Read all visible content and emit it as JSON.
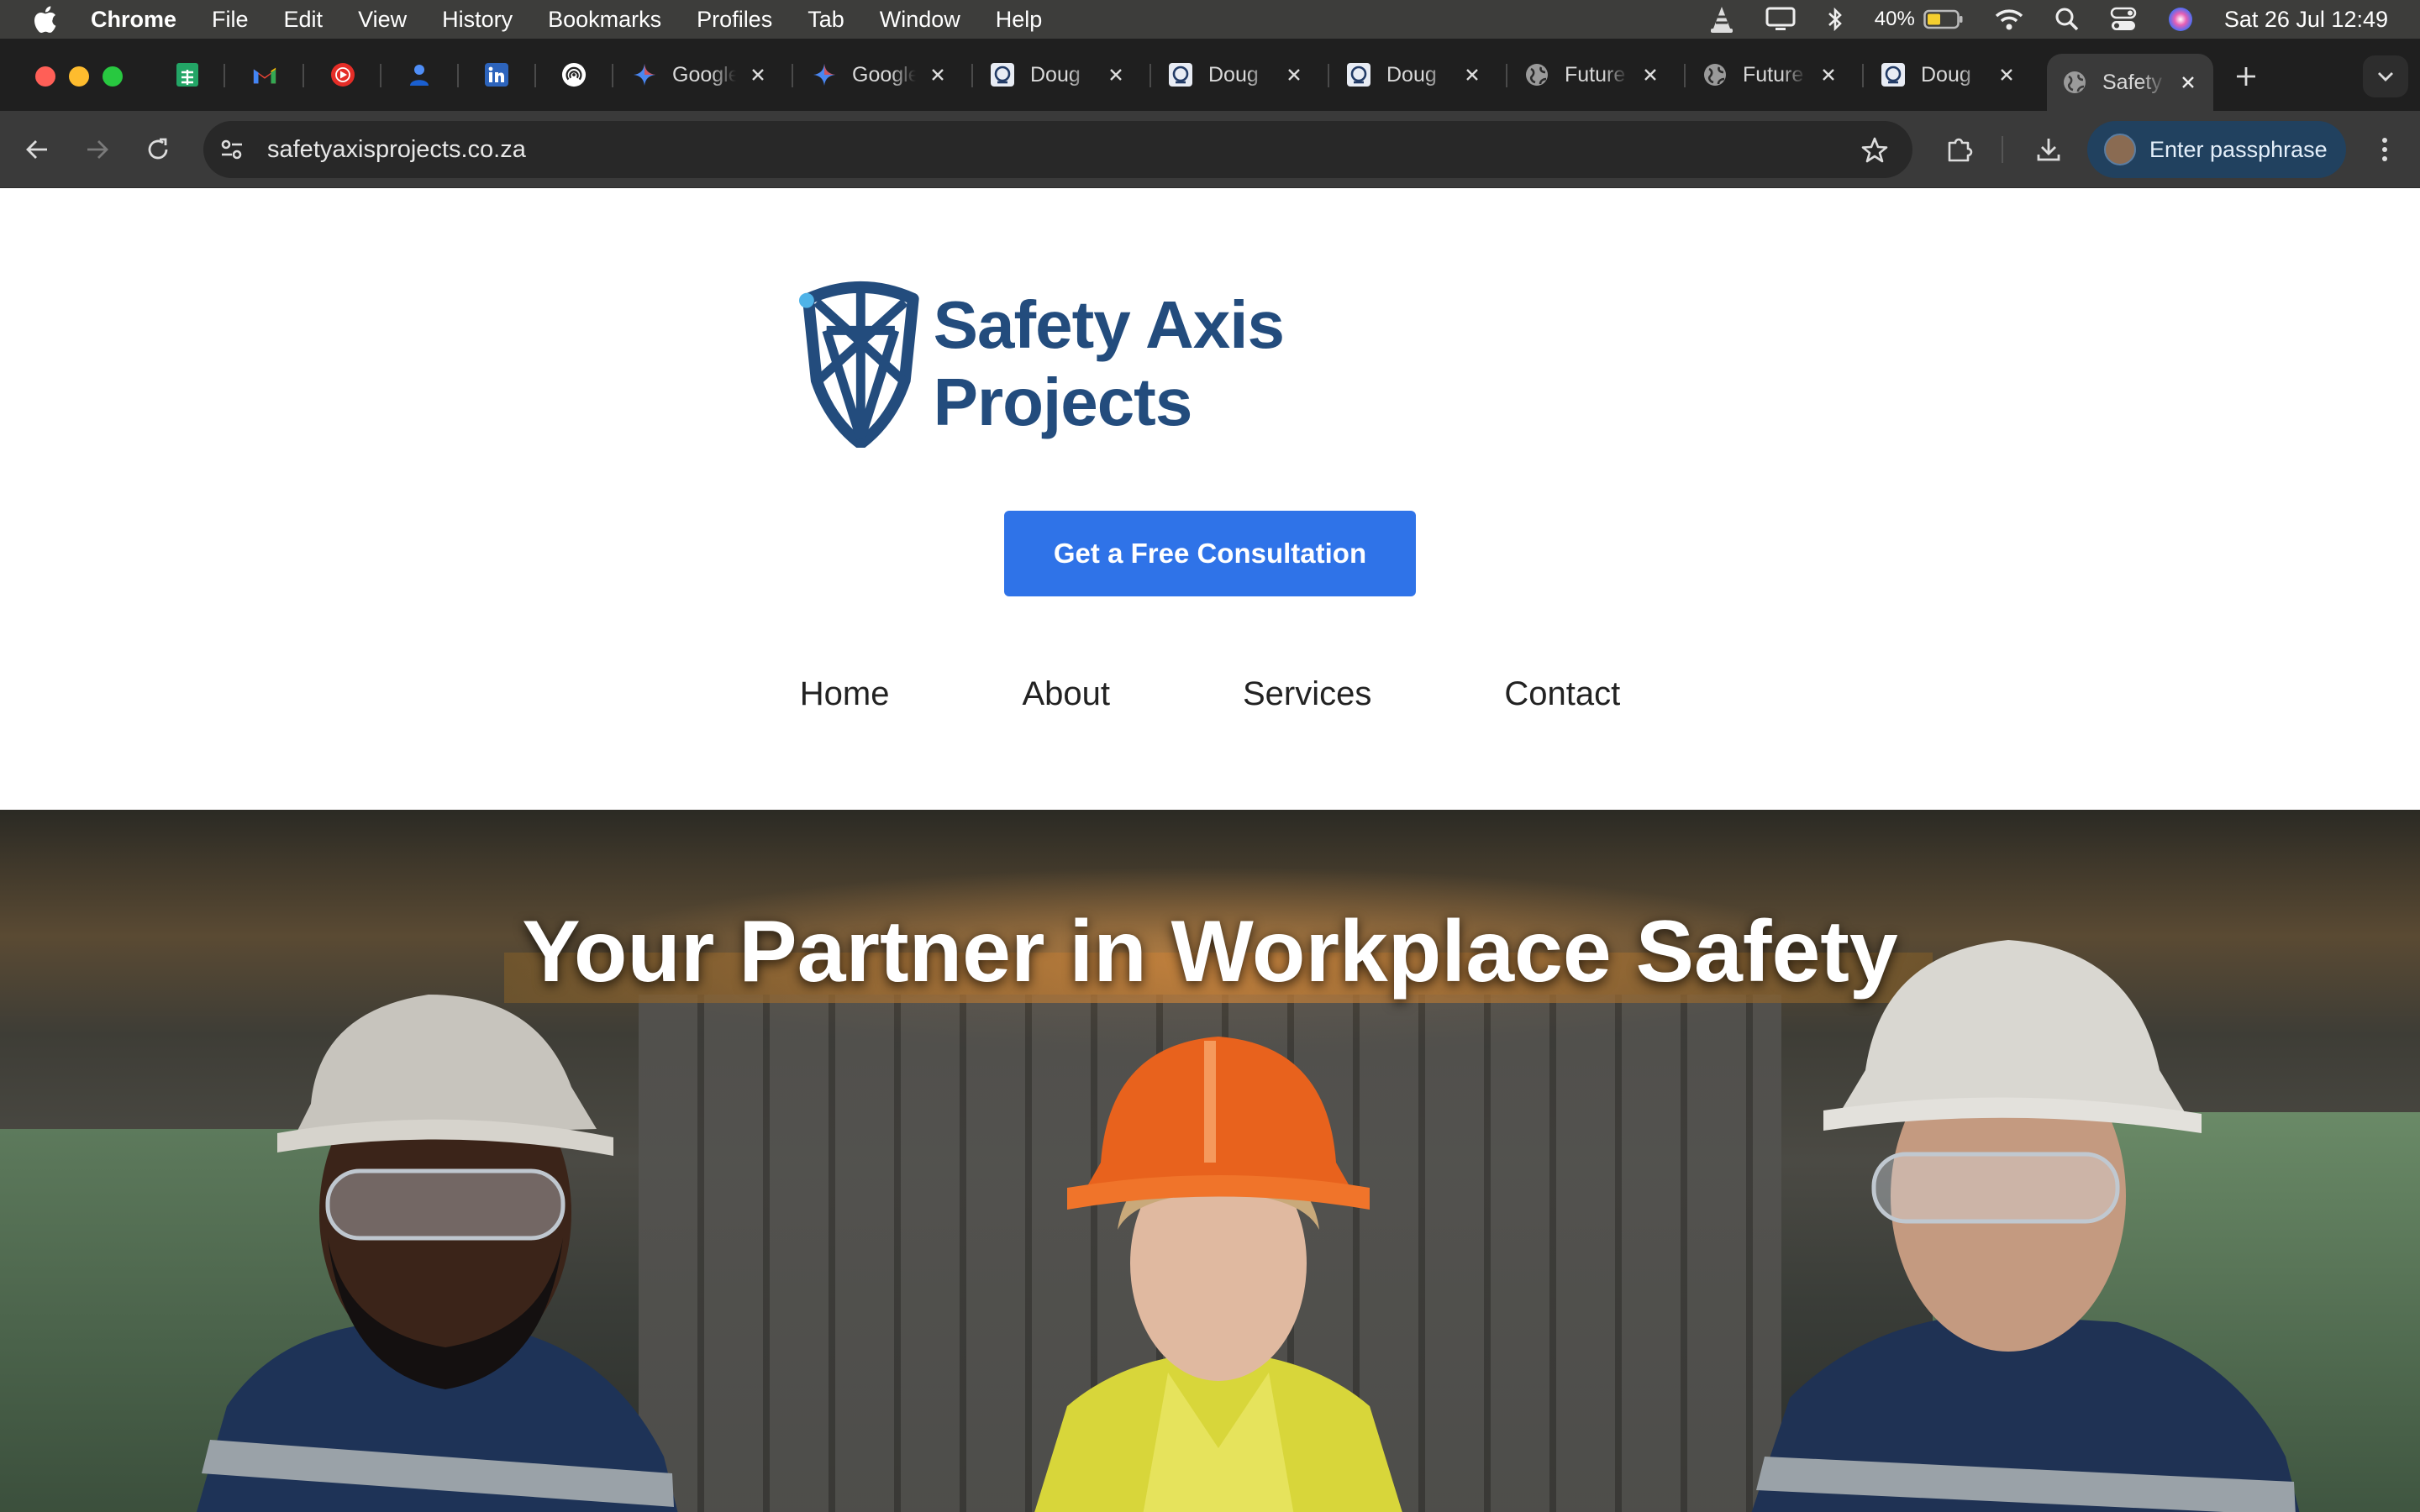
{
  "menubar": {
    "app_name": "Chrome",
    "items": [
      "File",
      "Edit",
      "View",
      "History",
      "Bookmarks",
      "Profiles",
      "Tab",
      "Window",
      "Help"
    ],
    "battery": "40%",
    "clock": "Sat 26 Jul  12:49"
  },
  "tabs": [
    {
      "label": "",
      "icon": "google-sheets-icon"
    },
    {
      "label": "",
      "icon": "gmail-icon"
    },
    {
      "label": "",
      "icon": "youtube-music-icon"
    },
    {
      "label": "",
      "icon": "contacts-icon"
    },
    {
      "label": "",
      "icon": "linkedin-icon"
    },
    {
      "label": "",
      "icon": "podcast-icon"
    },
    {
      "label": "Google",
      "icon": "gemini-icon"
    },
    {
      "label": "Google",
      "icon": "gemini-icon"
    },
    {
      "label": "Doug",
      "icon": "site-icon"
    },
    {
      "label": "Doug",
      "icon": "site-icon"
    },
    {
      "label": "Doug",
      "icon": "site-icon"
    },
    {
      "label": "Future",
      "icon": "globe-icon"
    },
    {
      "label": "Future",
      "icon": "globe-icon"
    },
    {
      "label": "Doug",
      "icon": "site-icon"
    },
    {
      "label": "Safety",
      "icon": "globe-icon",
      "active": true
    }
  ],
  "toolbar": {
    "url": "safetyaxisprojects.co.za",
    "profile_label": "Enter passphrase"
  },
  "site": {
    "brand_name": "Safety Axis Projects",
    "cta_label": "Get a Free Consultation",
    "nav": [
      "Home",
      "About",
      "Services",
      "Contact"
    ],
    "hero_title": "Your Partner in Workplace Safety"
  },
  "colors": {
    "brand_blue": "#234c7d",
    "cta_blue": "#2f73e8",
    "profile_chip": "#21415f"
  }
}
